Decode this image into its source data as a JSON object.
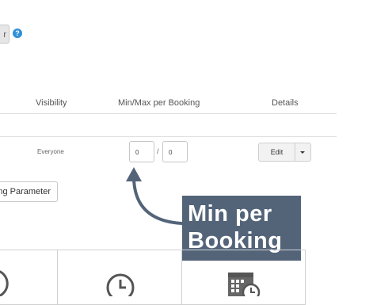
{
  "top": {
    "partial_button_label": "r",
    "help_icon_glyph": "?"
  },
  "table": {
    "headers": {
      "visibility": "Visibility",
      "minmax": "Min/Max per Booking",
      "details": "Details"
    },
    "row": {
      "visibility": "Everyone",
      "min": "0",
      "separator": "/",
      "max": "0",
      "edit_label": "Edit"
    }
  },
  "parameter_button_label": "ng Parameter",
  "callout": {
    "line1": "Min per",
    "line2": "Booking"
  },
  "icons": {
    "clock": "clock-icon",
    "calendar_clock": "calendar-clock-icon",
    "partial": "partial-icon"
  },
  "colors": {
    "callout_bg": "#536479",
    "arrow": "#536479",
    "help": "#2f8fd8"
  }
}
